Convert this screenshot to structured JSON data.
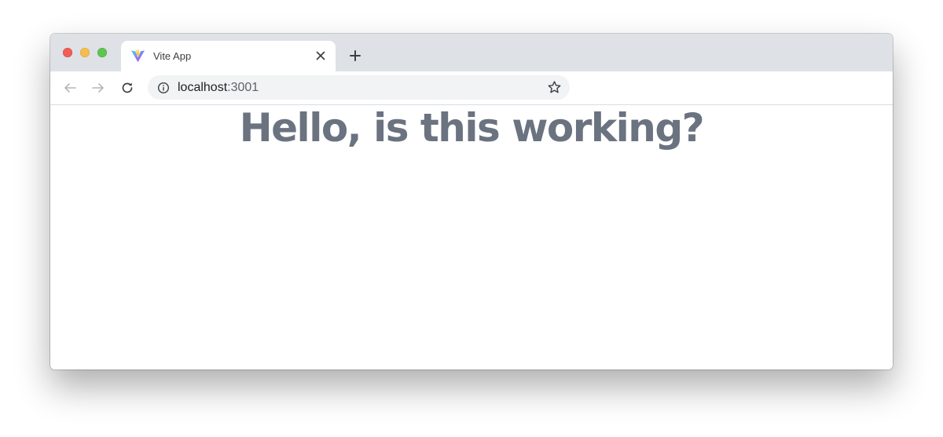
{
  "tab": {
    "title": "Vite App",
    "favicon": "vite-logo-icon"
  },
  "toolbar": {
    "url_host": "localhost",
    "url_port": ":3001"
  },
  "page": {
    "heading": "Hello, is this working?"
  },
  "colors": {
    "tabstrip": "#dee1e6",
    "heading": "#6b7280",
    "omnibox": "#f1f3f4"
  }
}
